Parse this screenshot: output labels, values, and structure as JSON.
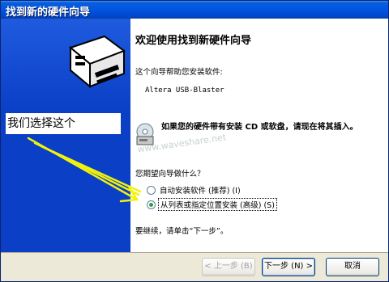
{
  "window": {
    "title": "找到新的硬件向导"
  },
  "content": {
    "heading": "欢迎使用找到新硬件向导",
    "intro": "这个向导帮助您安装软件:",
    "device": "Altera USB-Blaster",
    "cd_notice": "如果您的硬件带有安装 CD 或软盘，请现在将其插入。",
    "question": "您期望向导做什么？",
    "options": [
      {
        "label": "自动安装软件 (推荐) (I)",
        "selected": false
      },
      {
        "label": "从列表或指定位置安装 (高级) (S)",
        "selected": true
      }
    ],
    "continue_text": "要继续，请单击“下一步”。"
  },
  "annotation": {
    "text": "我们选择这个",
    "arrow_color": "#f2f20a"
  },
  "watermark": {
    "text": "www.waveshare.net"
  },
  "buttons": {
    "back": "< 上一步 (B)",
    "next": "下一步 (N) >",
    "cancel": "取消"
  },
  "colors": {
    "title_bar": "#0054e3",
    "left_panel": "#0a3fc6",
    "radio_selected": "#2ea23a"
  }
}
